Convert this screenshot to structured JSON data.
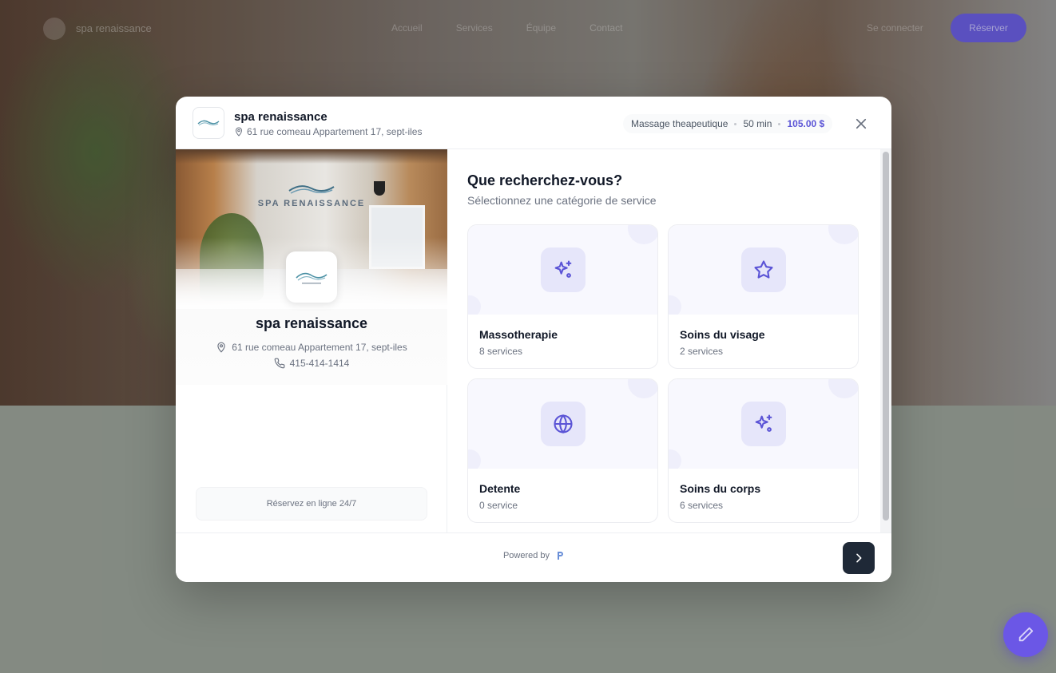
{
  "background": {
    "nav_links": [
      "Accueil",
      "Services",
      "Équipe",
      "Contact"
    ],
    "signin_label": "Se connecter",
    "cta_label": "Réserver"
  },
  "header": {
    "business_name": "spa renaissance",
    "address": "61 rue comeau Appartement 17, sept-iles",
    "summary": {
      "service": "Massage theapeutique",
      "duration": "50 min",
      "price": "105.00 $"
    },
    "icons": {
      "logo": "spa-renaissance-logo",
      "address": "map-pin-icon",
      "close": "close-icon"
    }
  },
  "sidebar": {
    "brand_text": "SPA RENAISSANCE",
    "business_name": "spa renaissance",
    "address": "61 rue comeau Appartement 17, sept-iles",
    "phone": "415-414-1414",
    "badge": "Réservez en ligne 24/7",
    "icons": {
      "address": "map-pin-icon",
      "phone": "phone-icon"
    }
  },
  "main": {
    "title": "Que recherchez-vous?",
    "subtitle": "Sélectionnez une catégorie de service",
    "categories": [
      {
        "name": "Massotherapie",
        "count": "8 services",
        "icon": "sparkles-icon"
      },
      {
        "name": "Soins du visage",
        "count": "2 services",
        "icon": "star-icon"
      },
      {
        "name": "Detente",
        "count": "0 service",
        "icon": "globe-icon"
      },
      {
        "name": "Soins du corps",
        "count": "6 services",
        "icon": "sparkles-icon"
      }
    ]
  },
  "footer": {
    "powered_by": "Powered by",
    "next_icon": "chevron-right-icon"
  },
  "colors": {
    "accent": "#5b54d6",
    "icon_bg": "#e6e6fa",
    "next_button": "#1f2937",
    "fab": "#6b57e6"
  }
}
